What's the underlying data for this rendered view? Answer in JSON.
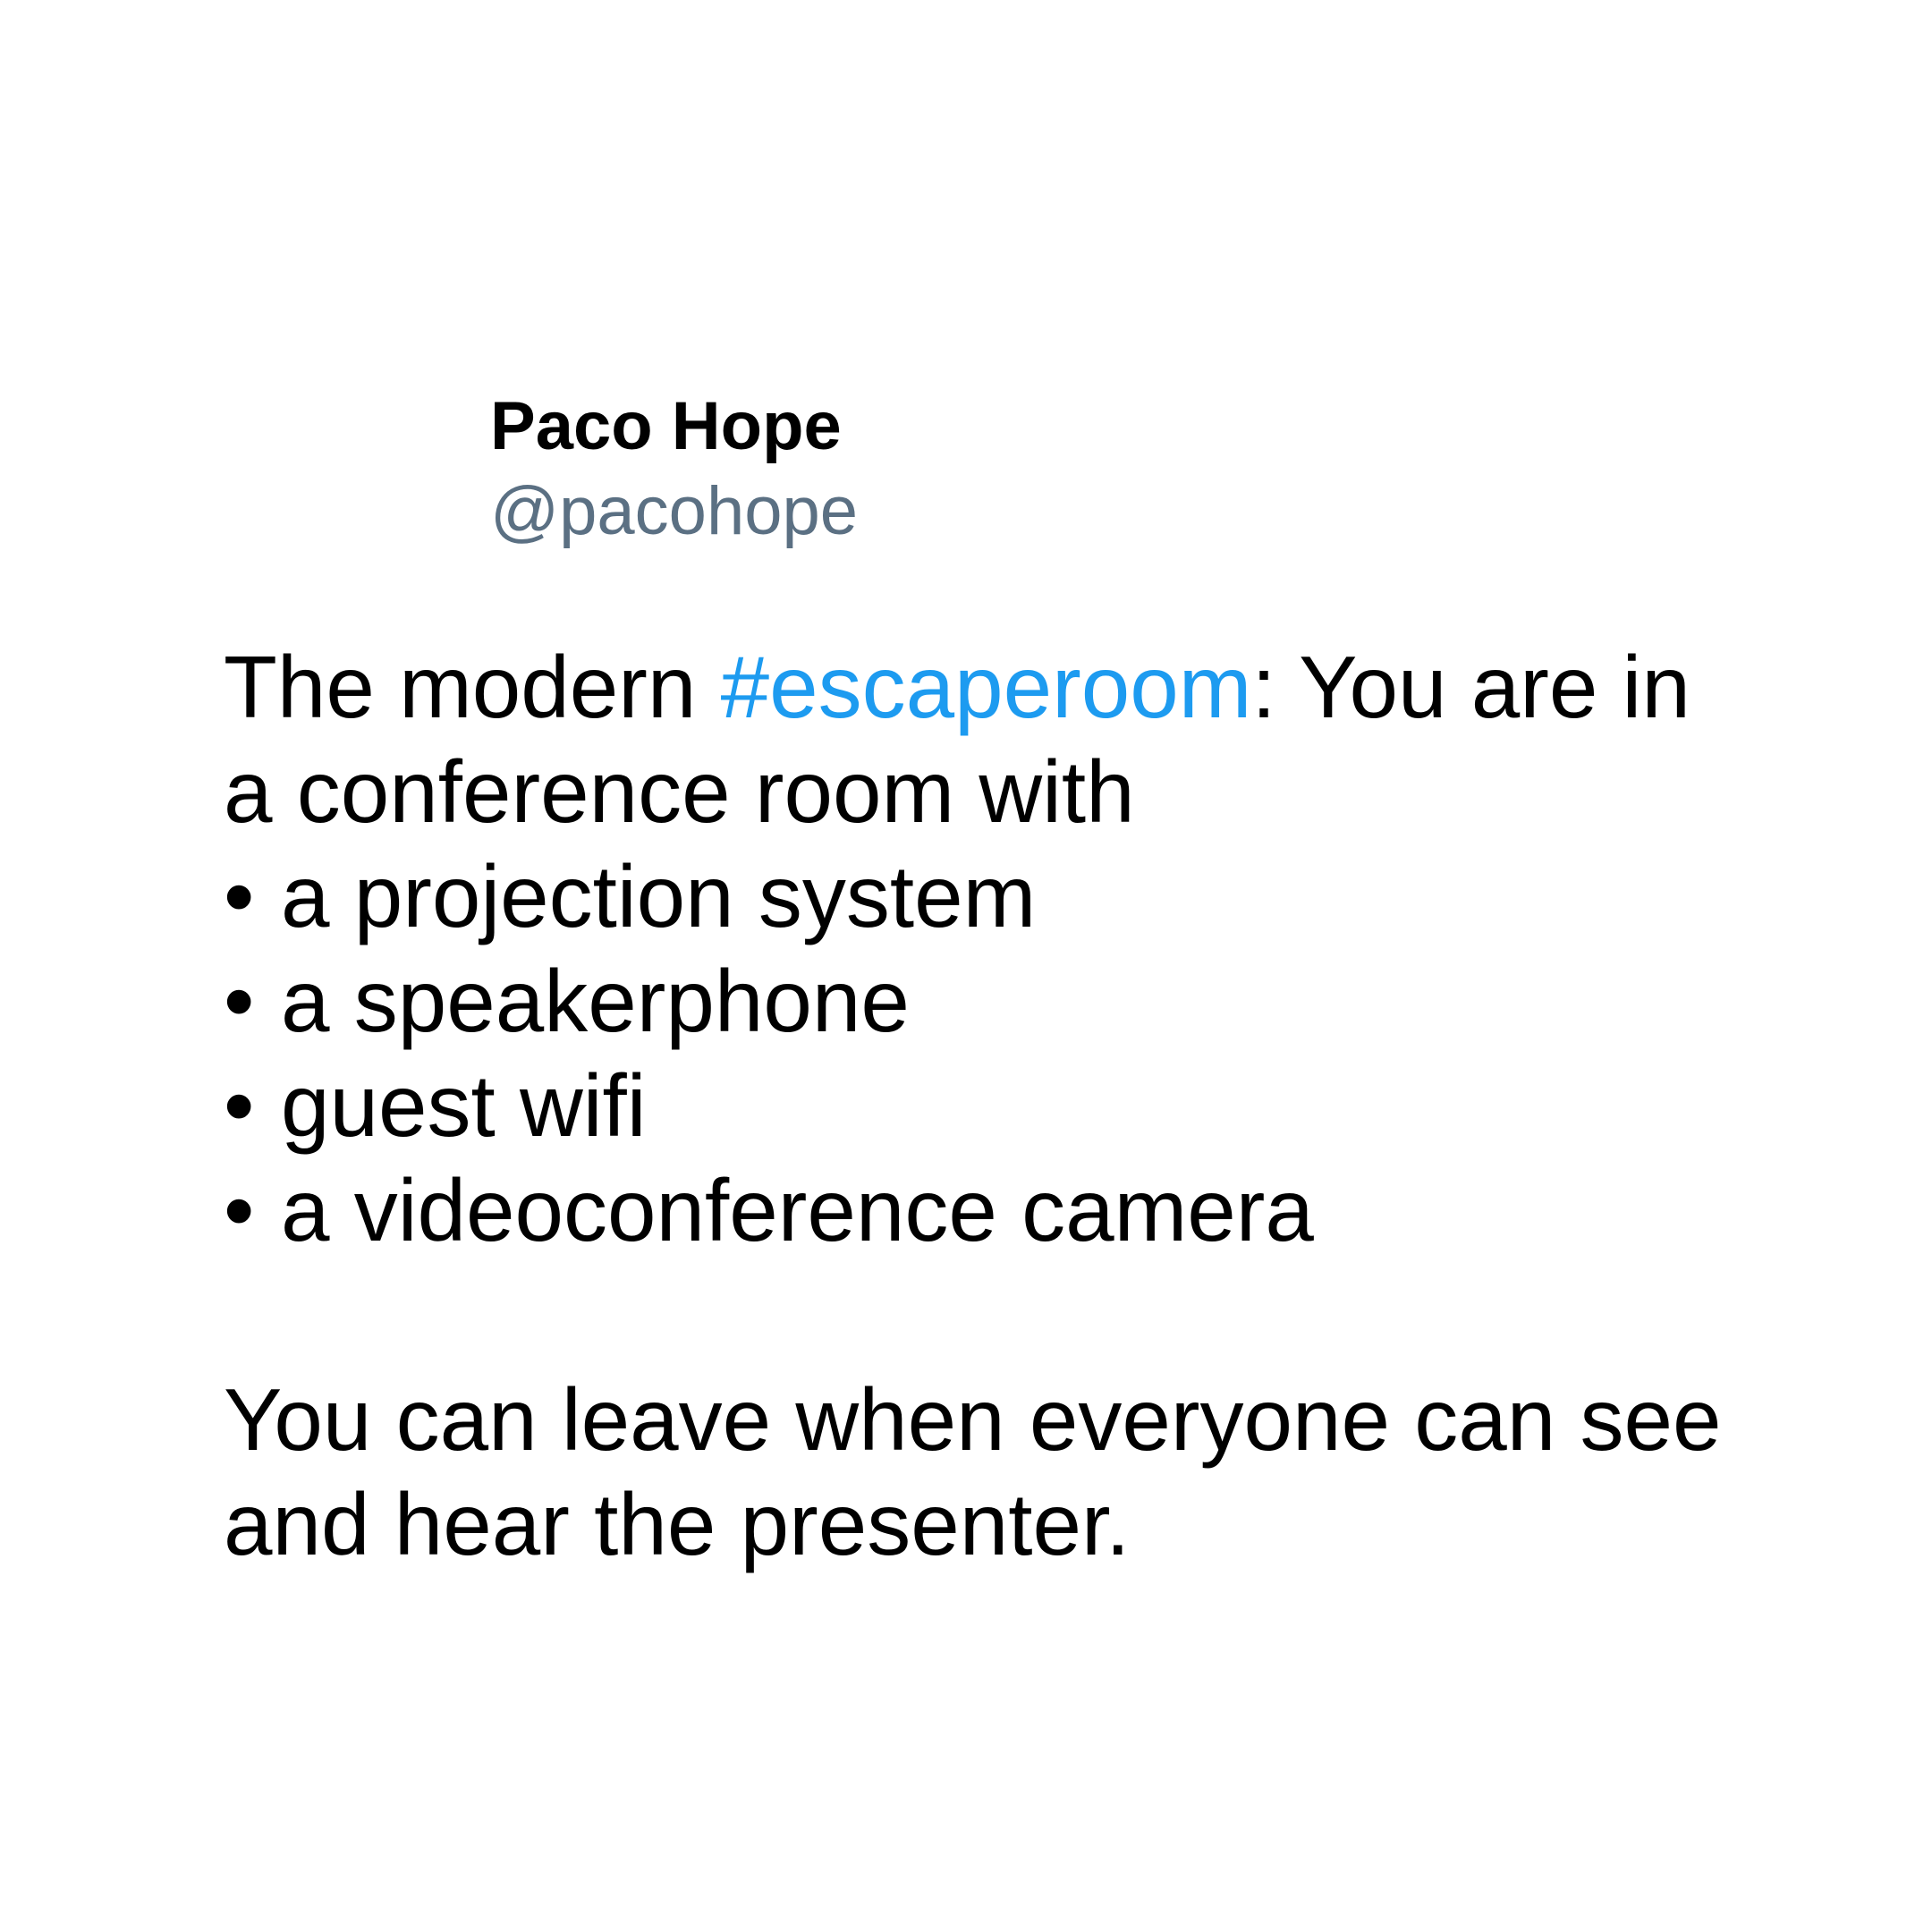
{
  "tweet": {
    "author_name": "Paco Hope",
    "author_handle": "@pacohope",
    "intro_before_hashtag": "The modern ",
    "hashtag": "#escaperoom",
    "intro_after_hashtag": ": You are in",
    "intro_line_2": "a conference room with",
    "bullet_symbol": "•",
    "items": [
      "a projection system",
      "a speakerphone",
      "guest wifi",
      "a videoconference camera"
    ],
    "closing_line_1": "You can leave when everyone can see",
    "closing_line_2": "and hear the presenter.",
    "colors": {
      "text": "#000000",
      "handle": "#5b7083",
      "hashtag": "#1d9bf0",
      "background": "#ffffff"
    }
  }
}
